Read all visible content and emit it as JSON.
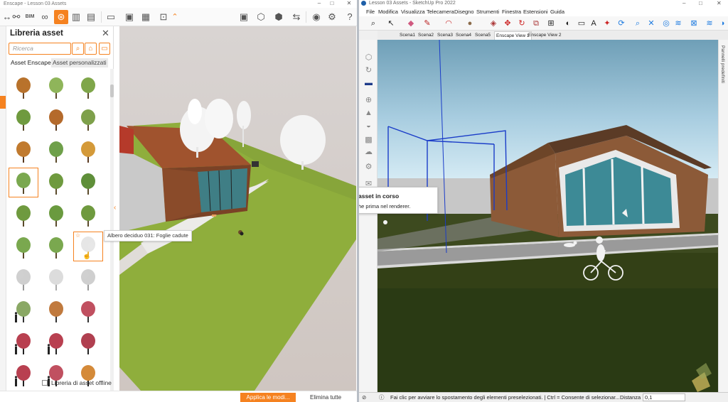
{
  "enscape": {
    "title": "Enscape - Lesson 03 Assets",
    "toolbar": {
      "icons": [
        "arrows-icon",
        "link-icon",
        "bim-icon",
        "binoculars-icon",
        "asset-library-icon",
        "building-icon",
        "books-icon",
        "document-icon",
        "image-icon",
        "video-icon",
        "window-icon",
        "screen-icon",
        "export-icon",
        "panorama-icon",
        "sync-icon",
        "eye-icon",
        "settings-icon",
        "help-icon"
      ],
      "bim_label": "BIM",
      "accent": "#f58220"
    },
    "library": {
      "title": "Libreria asset",
      "search_placeholder": "Ricerca",
      "tabs": [
        "Asset Enscape",
        "Asset personalizzati"
      ],
      "offline_label": "Libreria di asset offline",
      "tooltip": "Albero deciduo 031: Foglie cadute"
    },
    "buttons": {
      "apply": "Applica le modi...",
      "delete_all": "Elimina tutte"
    }
  },
  "sketchup": {
    "title": "Lesson 03 Assets - SketchUp Pro 2022",
    "menu": [
      "File",
      "Modifica",
      "Visualizza",
      "Telecamera",
      "Disegno",
      "Strumenti",
      "Finestra",
      "Estensioni",
      "Guida"
    ],
    "scenes": [
      "Scena1",
      "Scena2",
      "Scena3",
      "Scena4",
      "Scena5",
      "Enscape View 1",
      "Enscape View 2"
    ],
    "current_scene_index": 5,
    "right_panel": "Pannelli predefiniti",
    "popup": {
      "line1": "asset in corso",
      "line2": "he prima nel renderer."
    },
    "status": {
      "message": "Fai clic per avviare lo spostamento degli elementi preselezionati. | Ctrl = Consente di selezionar...",
      "distance_label": "Distanza",
      "distance_value": "0,1"
    }
  }
}
